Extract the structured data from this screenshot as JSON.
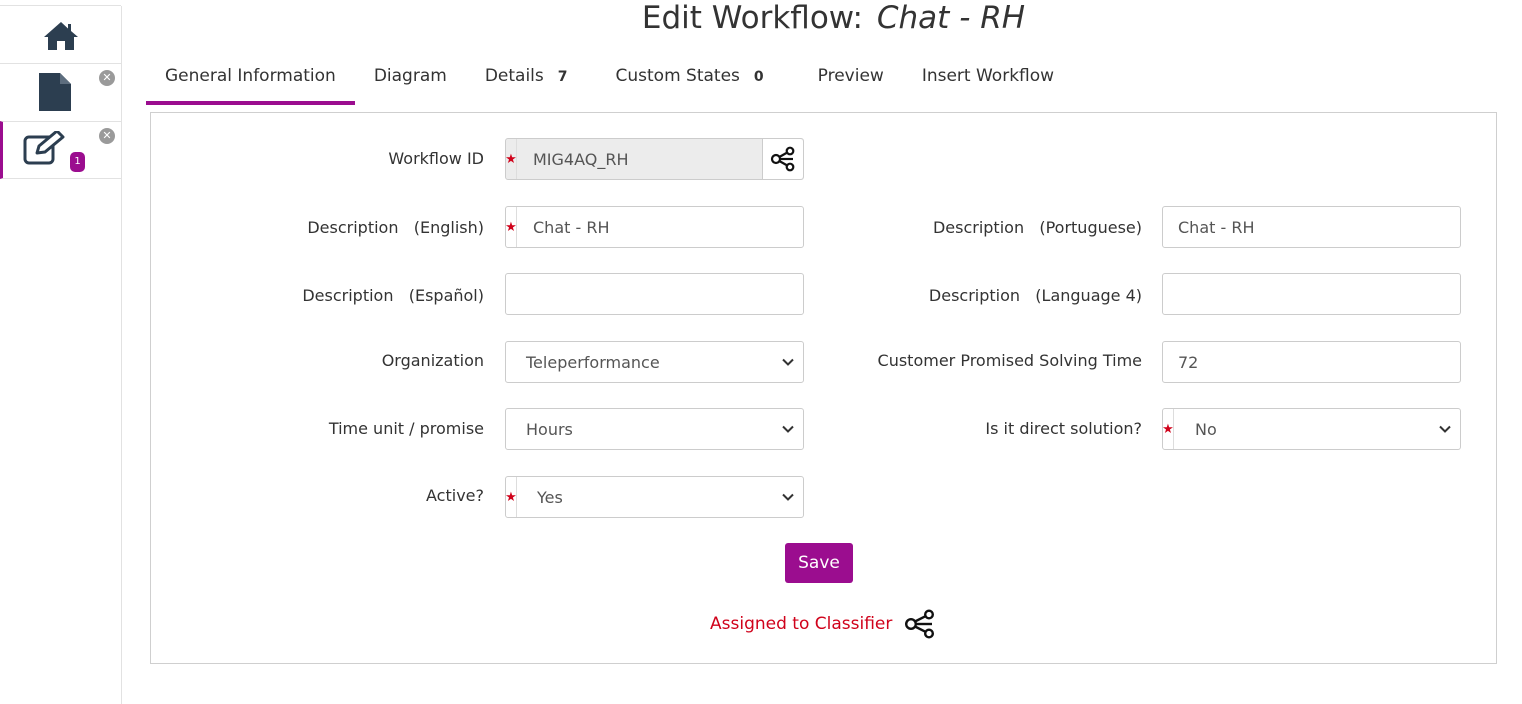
{
  "title": {
    "prefix": "Edit Workflow:",
    "workflow_name": "Chat - RH"
  },
  "sidebar": {
    "edit_badge": "1",
    "close_glyph": "✕"
  },
  "tabs": [
    {
      "label": "General Information",
      "count": ""
    },
    {
      "label": "Diagram",
      "count": ""
    },
    {
      "label": "Details",
      "count": "7"
    },
    {
      "label": "Custom States",
      "count": "0"
    },
    {
      "label": "Preview",
      "count": ""
    },
    {
      "label": "Insert Workflow",
      "count": ""
    }
  ],
  "form": {
    "workflow_id": {
      "label": "Workflow ID",
      "value": "MIG4AQ_RH"
    },
    "desc_english": {
      "label": "Description   (English)",
      "value": "Chat - RH"
    },
    "desc_portuguese": {
      "label": "Description   (Portuguese)",
      "value": "Chat - RH"
    },
    "desc_espanol": {
      "label": "Description   (Español)",
      "value": ""
    },
    "desc_lang4": {
      "label": "Description   (Language 4)",
      "value": ""
    },
    "organization": {
      "label": "Organization",
      "value": "Teleperformance"
    },
    "promised_time": {
      "label": "Customer Promised Solving Time",
      "value": "72"
    },
    "time_unit": {
      "label": "Time unit / promise",
      "value": "Hours"
    },
    "direct_solution": {
      "label": "Is it direct solution?",
      "value": "No"
    },
    "active": {
      "label": "Active?",
      "value": "Yes"
    },
    "required_star": "★"
  },
  "save_label": "Save",
  "assigned_label": "Assigned to Classifier",
  "colors": {
    "accent": "#9b0d8f",
    "required": "#d0021b"
  }
}
